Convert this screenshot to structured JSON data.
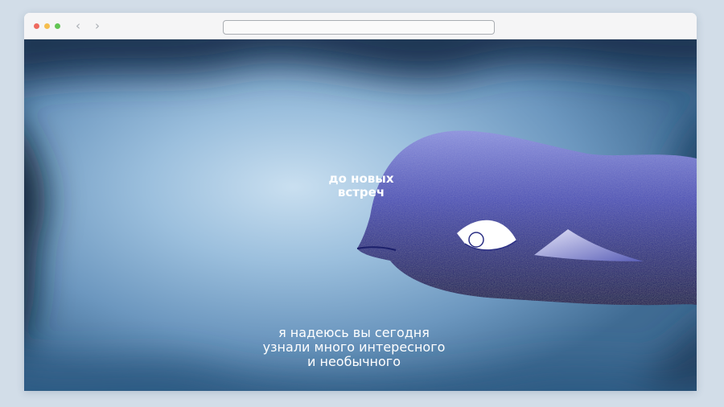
{
  "browser": {
    "back_icon": "chevron-left-icon",
    "forward_icon": "chevron-right-icon",
    "address_value": ""
  },
  "scene": {
    "caption_top": "до новых\nвстреч",
    "caption_bottom": "я надеюсь вы сегодня\nузнали много интересного\nи необычного",
    "colors": {
      "water_light": "#c9dff0",
      "water_mid": "#7ea8cc",
      "water_deep": "#0f2034",
      "fish_top": "#7b82d6",
      "fish_bottom": "#0c0f4e",
      "eye": "#ffffff"
    }
  }
}
